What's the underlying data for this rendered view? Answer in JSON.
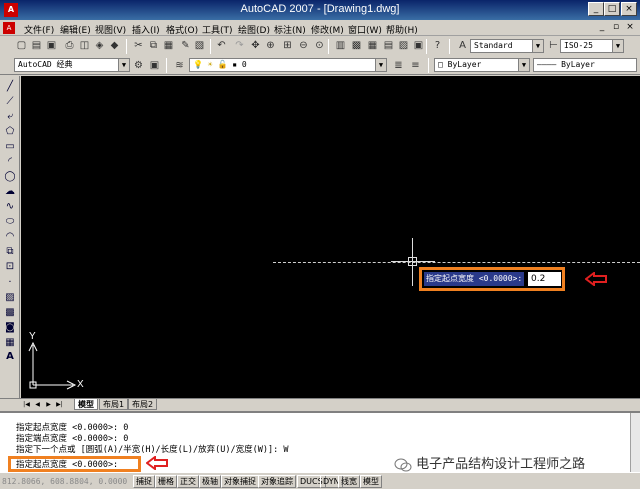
{
  "window": {
    "app_icon": "A",
    "title": "AutoCAD 2007 - [Drawing1.dwg]",
    "minimize": "_",
    "maximize": "□",
    "close": "×"
  },
  "menubar": {
    "doc_icon": "A",
    "items": [
      "文件(F)",
      "编辑(E)",
      "视图(V)",
      "插入(I)",
      "格式(O)",
      "工具(T)",
      "绘图(D)",
      "标注(N)",
      "修改(M)",
      "窗口(W)",
      "帮助(H)"
    ],
    "doc_minimize": "_",
    "doc_restore": "▫",
    "doc_close": "×"
  },
  "toolbar_standard": {
    "text_style": "Standard",
    "dim_style": "ISO-25"
  },
  "toolbar_layers": {
    "workspace": "AutoCAD 经典",
    "layer": "0",
    "color": "ByLayer",
    "linetype": "ByLayer"
  },
  "canvas": {
    "dynamic_prompt": "指定起点宽度 <0.0000>:",
    "dynamic_value": "0.2",
    "ucs_x": "X",
    "ucs_y": "Y"
  },
  "tabs": {
    "items": [
      "模型",
      "布局1",
      "布局2"
    ]
  },
  "command": {
    "history": [
      "指定起点宽度 <0.0000>: 0",
      "指定端点宽度 <0.0000>: 0",
      "指定下一个点或 [圆弧(A)/半宽(H)/长度(L)/放弃(U)/宽度(W)]: W"
    ],
    "prompt": "指定起点宽度 <0.0000>:"
  },
  "watermark": "电子产品结构设计工程师之路",
  "statusbar": {
    "coords": "812.8066, 608.8804, 0.0000",
    "buttons": [
      "捕捉",
      "栅格",
      "正交",
      "极轴",
      "对象捕捉",
      "对象追踪",
      "DUCS",
      "DYN",
      "线宽",
      "模型"
    ]
  },
  "colors": {
    "highlight": "#f08020",
    "arrow": "#e02020",
    "canvas_bg": "#000000",
    "titlebar": "#0a246a"
  }
}
